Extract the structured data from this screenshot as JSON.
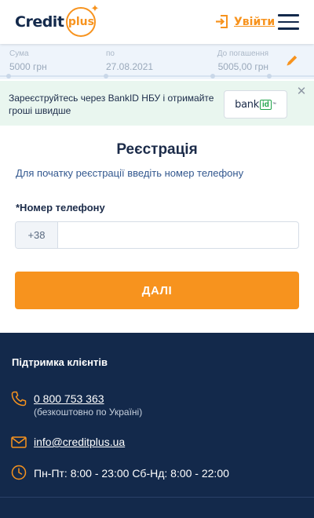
{
  "header": {
    "logo_word": "Credit",
    "logo_circle_word": "plus",
    "login_label": "Увійти"
  },
  "summary": {
    "sum_label": "Сума",
    "sum_value": "5000 грн",
    "date_label": "по",
    "date_value": "27.08.2021",
    "repay_label": "До погашення",
    "repay_value": "5005,00 грн"
  },
  "banner": {
    "text": "Зареєструйтесь через BankID НБУ і отримайте гроші швидше",
    "button_word": "bank",
    "button_box": "id",
    "button_tm": "™"
  },
  "registration": {
    "title": "Реєстрація",
    "subtitle": "Для початку реєстрації введіть номер телефону",
    "phone_label": "*Номер телефону",
    "phone_prefix": "+38",
    "phone_value": "",
    "next_label": "ДАЛІ"
  },
  "footer": {
    "support_title": "Підтримка клієнтів",
    "phone": "0 800 753 363",
    "phone_note": "(безкоштовно по Україні)",
    "email": "info@creditplus.ua",
    "hours": "Пн-Пт: 8:00 - 23:00 Сб-Нд: 8:00 - 22:00"
  },
  "colors": {
    "accent": "#f7931e",
    "navy": "#13294b",
    "banner_bg": "#e9f6ef",
    "summary_bg": "#eef4fb"
  },
  "icons": {
    "login": "login-arrow-icon",
    "menu": "hamburger-menu-icon",
    "edit": "pencil-icon",
    "close": "close-icon",
    "phone": "phone-icon",
    "mail": "mail-icon",
    "clock": "clock-icon"
  }
}
